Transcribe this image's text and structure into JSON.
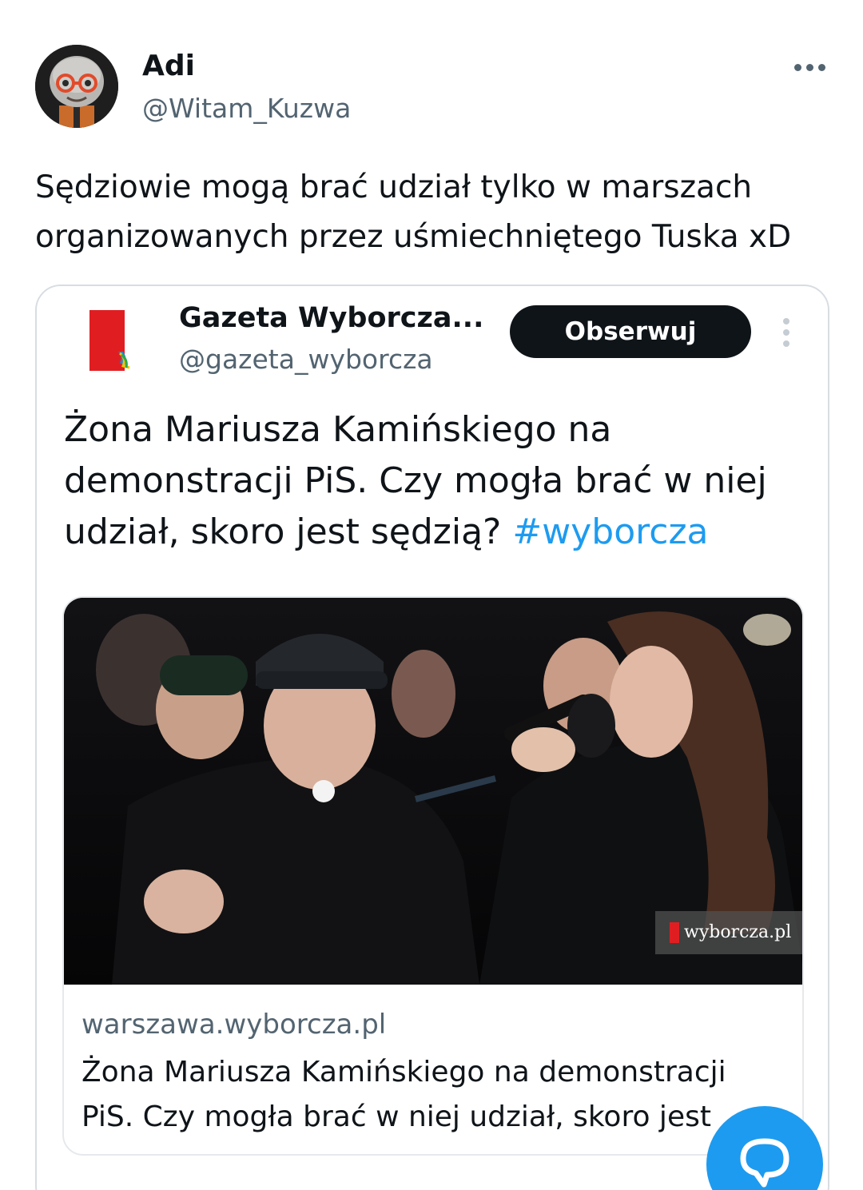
{
  "tweet": {
    "author_name": "Adi",
    "author_handle": "@Witam_Kuzwa",
    "text": "Sędziowie mogą brać udział tylko w marszach organizowanych przez uśmiechniętego Tuska xD"
  },
  "quoted": {
    "author_name": "Gazeta Wyborcza...",
    "author_handle": "@gazeta_wyborcza",
    "follow_label": "Obserwuj",
    "text": "Żona Mariusza Kamińskiego na demonstracji PiS. Czy mogła brać w niej udział, skoro jest sędzią?",
    "hashtag": "#wyborcza",
    "card": {
      "domain": "warszawa.wyborcza.pl",
      "title": "Żona Mariusza Kamińskiego na demonstracji PiS. Czy mogła brać w niej udział, skoro jest",
      "watermark": "wyborcza.pl"
    }
  },
  "icons": {
    "more": "more-horizontal-icon",
    "quoted_more": "more-vertical-icon",
    "reply": "reply-bubble-icon"
  },
  "colors": {
    "accent": "#1d9bf0",
    "text": "#0f1419",
    "muted": "#536471",
    "button_bg": "#0f1419",
    "brand_red": "#e01e22"
  }
}
